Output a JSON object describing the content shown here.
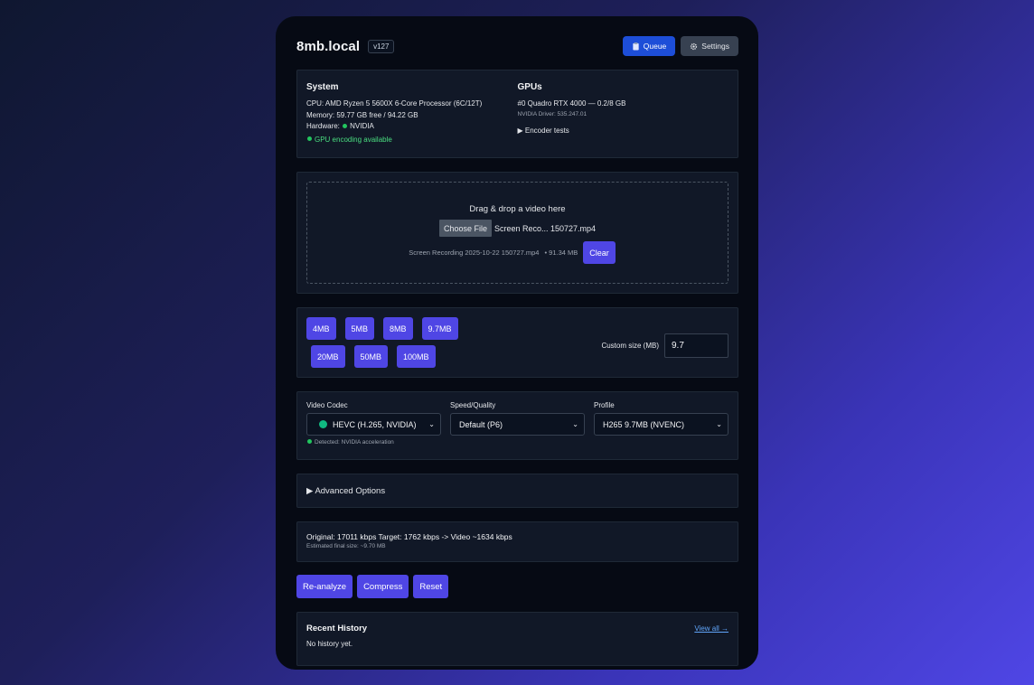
{
  "app": {
    "title": "8mb.local",
    "version": "v127",
    "queue_label": "Queue",
    "settings_label": "Settings"
  },
  "system": {
    "title": "System",
    "cpu": "CPU: AMD Ryzen 5 5600X 6-Core Processor (6C/12T)",
    "memory": "Memory: 59.77 GB free / 94.22 GB",
    "hardware_label": "Hardware:",
    "hardware_value": "NVIDIA",
    "gpu_status": "GPU encoding available"
  },
  "gpus": {
    "title": "GPUs",
    "gpu0": "#0 Quadro RTX 4000 — 0.2/8 GB",
    "driver": "NVIDIA Driver: 535.247.01",
    "encoder_tests": "Encoder tests"
  },
  "upload": {
    "drop_title": "Drag & drop a video here",
    "choose_file": "Choose File",
    "file_name_short": "Screen Reco... 150727.mp4",
    "file_full": "Screen Recording 2025-10-22 150727.mp4",
    "file_size": "• 91.34 MB",
    "clear_label": "Clear"
  },
  "sizes": {
    "presets_row1": [
      "4MB",
      "5MB",
      "8MB",
      "9.7MB"
    ],
    "presets_row2": [
      "20MB",
      "50MB",
      "100MB"
    ],
    "custom_label": "Custom size (MB)",
    "custom_value": "9.7"
  },
  "codec": {
    "codec_label": "Video Codec",
    "codec_value": "HEVC (H.265, NVIDIA)",
    "speed_label": "Speed/Quality",
    "speed_value": "Default (P6)",
    "profile_label": "Profile",
    "profile_value": "H265 9.7MB (NVENC)",
    "detected": "Detected: NVIDIA acceleration"
  },
  "advanced": {
    "label": "Advanced Options"
  },
  "estimate": {
    "main": "Original: 17011 kbps Target: 1762 kbps -> Video ~1634 kbps",
    "sub": "Estimated final size: ~9.70 MB"
  },
  "actions": {
    "reanalyze": "Re-analyze",
    "compress": "Compress",
    "reset": "Reset"
  },
  "history": {
    "title": "Recent History",
    "view_all": "View all →",
    "empty": "No history yet."
  },
  "colors": {
    "accent": "#4f46e5",
    "queue_button": "#1d4ed8",
    "success": "#22c55e",
    "card_bg": "#111827",
    "panel_bg": "#060a14"
  }
}
